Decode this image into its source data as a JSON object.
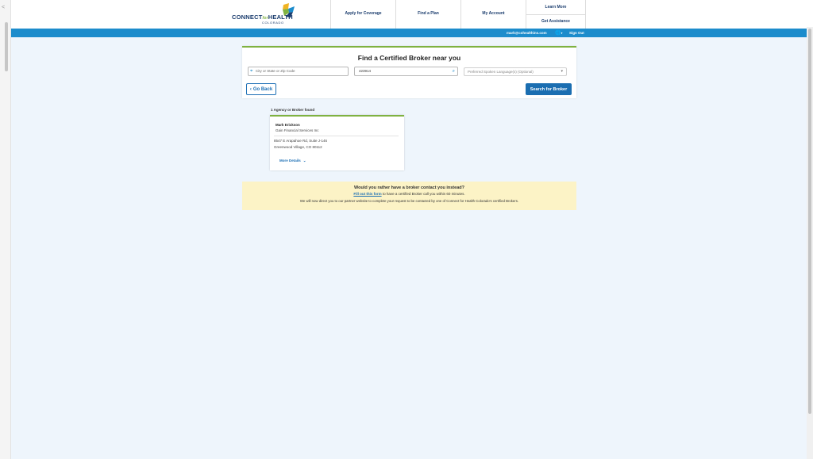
{
  "header": {
    "logo": {
      "name": "CONNECT",
      "tagline": "HEALTH",
      "connector": "for",
      "region": "COLORADO"
    },
    "nav": [
      {
        "label": "Apply for Coverage"
      },
      {
        "label": "Find a Plan"
      },
      {
        "label": "My Account"
      }
    ],
    "nav_stack": [
      {
        "label": "Learn More"
      },
      {
        "label": "Get Assistance"
      }
    ]
  },
  "userbar": {
    "email": "mark@cohealthins.com",
    "language_icon": "globe-icon",
    "language_caret": "▾",
    "signout_label": "Sign Out"
  },
  "search": {
    "title": "Find a Certified Broker near you",
    "location_placeholder": "City or State or Zip Code",
    "zip_value": "423914",
    "language_placeholder": "Preferred Spoken Language(s) (Optional)",
    "back_label": "Go Back",
    "search_label": "Search for Broker"
  },
  "results": {
    "count_label": "1 Agency or Broker found",
    "brokers": [
      {
        "name": "Mark Erickson",
        "agency": "Gain Financial Services Inc",
        "address_line1": "8547 E Arapahoe Rd, Suite J-146",
        "address_line2": "Greenwood Village, CO 80112",
        "more_label": "More Details"
      }
    ]
  },
  "contact_banner": {
    "question": "Would you rather have a broker contact you instead?",
    "link_text": "Fill out this form",
    "line2_rest": " to have a certified Broker call you within 60 minutes.",
    "line3": "We will now direct you to our partner website to complete your request to be contacted by one of Connect for Health Colorado's certified Brokers."
  },
  "colors": {
    "primary_blue": "#1c8ccc",
    "button_blue": "#1b6eb1",
    "accent_green": "#7fb241",
    "banner_yellow": "#fcf3c6",
    "page_bg": "#eef5fc"
  }
}
